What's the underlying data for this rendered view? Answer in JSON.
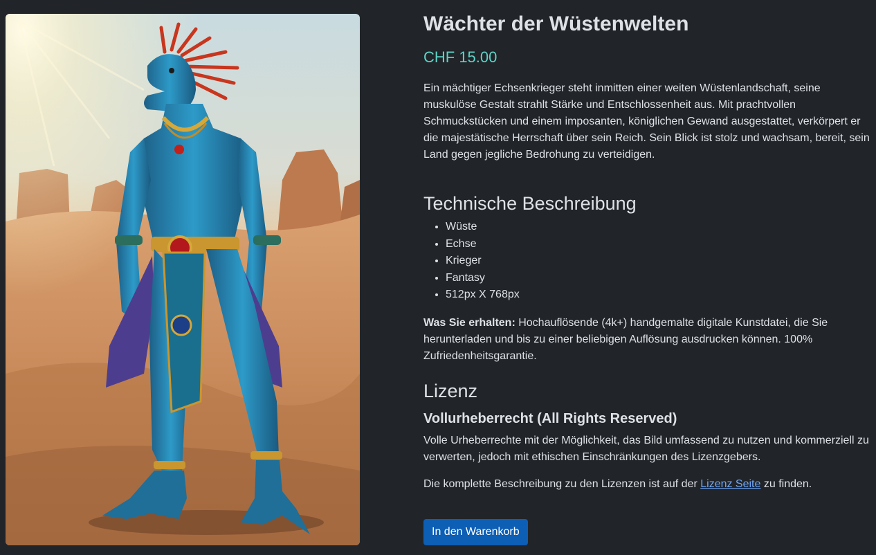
{
  "product": {
    "image_alt": "Blue lizard warrior in desert",
    "title": "Wächter der Wüstenwelten",
    "price": "CHF 15.00",
    "description": "Ein mächtiger Echsenkrieger steht inmitten einer weiten Wüstenlandschaft, seine muskulöse Gestalt strahlt Stärke und Entschlossenheit aus. Mit prachtvollen Schmuckstücken und einem imposanten, königlichen Gewand ausgestattet, verkörpert er die majestätische Herrschaft über sein Reich. Sein Blick ist stolz und wachsam, bereit, sein Land gegen jegliche Bedrohung zu verteidigen."
  },
  "technical": {
    "heading": "Technische Beschreibung",
    "tags": [
      "Wüste",
      "Echse",
      "Krieger",
      "Fantasy",
      "512px X 768px"
    ]
  },
  "what_you_get": {
    "label": "Was Sie erhalten:",
    "text": " Hochauflösende (4k+) handgemalte digitale Kunstdatei, die Sie herunterladen und bis zu einer beliebigen Auflösung ausdrucken können. 100% Zufriedenheitsgarantie."
  },
  "license": {
    "heading": "Lizenz",
    "name": "Vollurheberrecht (All Rights Reserved)",
    "description": "Volle Urheberrechte mit der Möglichkeit, das Bild umfassend zu nutzen und kommerziell zu verwerten, jedoch mit ethischen Einschränkungen des Lizenzgebers.",
    "note_before": "Die komplette Beschreibung zu den Lizenzen ist auf der ",
    "link_text": "Lizenz Seite",
    "note_after": " zu finden."
  },
  "cart": {
    "button_label": "In den Warenkorb"
  },
  "colors": {
    "background": "#212529",
    "price": "#5ed3c7",
    "link": "#6ea8fe",
    "button": "#0d5eb5"
  }
}
